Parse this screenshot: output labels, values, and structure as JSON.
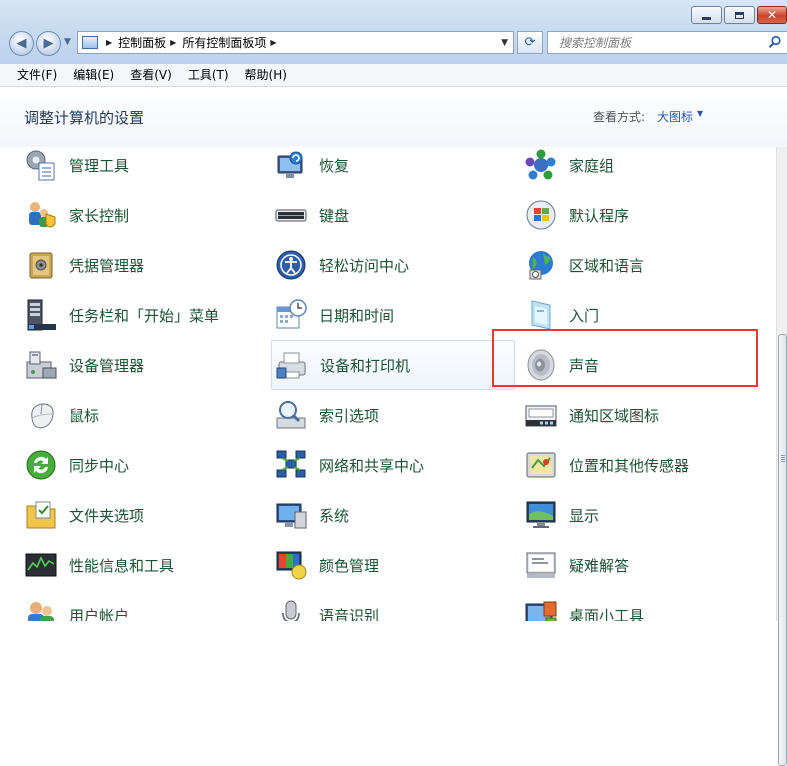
{
  "window": {
    "min_glyph": "—",
    "close_glyph": "✕"
  },
  "navigation": {
    "back_icon": "arrow-left-icon",
    "forward_icon": "arrow-right-icon",
    "address_crumbs": [
      "控制面板",
      "所有控制面板项"
    ],
    "refresh_icon": "refresh-icon",
    "search_placeholder": "搜索控制面板"
  },
  "menubar": {
    "items": [
      "文件(F)",
      "编辑(E)",
      "查看(V)",
      "工具(T)",
      "帮助(H)"
    ]
  },
  "content": {
    "title": "调整计算机的设置",
    "view_by_label": "查看方式:",
    "view_by_value": "大图标"
  },
  "items": [
    {
      "label": "管理工具",
      "icon": "admin-tools-icon"
    },
    {
      "label": "恢复",
      "icon": "recovery-icon"
    },
    {
      "label": "家庭组",
      "icon": "homegroup-icon"
    },
    {
      "label": "家长控制",
      "icon": "parental-controls-icon"
    },
    {
      "label": "键盘",
      "icon": "keyboard-icon"
    },
    {
      "label": "默认程序",
      "icon": "default-programs-icon"
    },
    {
      "label": "凭据管理器",
      "icon": "credential-manager-icon"
    },
    {
      "label": "轻松访问中心",
      "icon": "ease-of-access-icon"
    },
    {
      "label": "区域和语言",
      "icon": "region-language-icon"
    },
    {
      "label": "任务栏和「开始」菜单",
      "icon": "taskbar-icon"
    },
    {
      "label": "日期和时间",
      "icon": "date-time-icon"
    },
    {
      "label": "入门",
      "icon": "getting-started-icon"
    },
    {
      "label": "设备管理器",
      "icon": "device-manager-icon"
    },
    {
      "label": "设备和打印机",
      "icon": "devices-printers-icon"
    },
    {
      "label": "声音",
      "icon": "sound-icon"
    },
    {
      "label": "鼠标",
      "icon": "mouse-icon"
    },
    {
      "label": "索引选项",
      "icon": "indexing-options-icon"
    },
    {
      "label": "通知区域图标",
      "icon": "notification-area-icon"
    },
    {
      "label": "同步中心",
      "icon": "sync-center-icon"
    },
    {
      "label": "网络和共享中心",
      "icon": "network-sharing-icon"
    },
    {
      "label": "位置和其他传感器",
      "icon": "location-sensors-icon"
    },
    {
      "label": "文件夹选项",
      "icon": "folder-options-icon"
    },
    {
      "label": "系统",
      "icon": "system-icon"
    },
    {
      "label": "显示",
      "icon": "display-icon"
    },
    {
      "label": "性能信息和工具",
      "icon": "performance-icon"
    },
    {
      "label": "颜色管理",
      "icon": "color-management-icon"
    },
    {
      "label": "疑难解答",
      "icon": "troubleshooting-icon"
    },
    {
      "label": "用户帐户",
      "icon": "user-accounts-icon"
    },
    {
      "label": "语音识别",
      "icon": "speech-recognition-icon"
    },
    {
      "label": "桌面小工具",
      "icon": "desktop-gadgets-icon"
    }
  ],
  "colors": {
    "item_label": "#1c5233",
    "title": "#1e395b",
    "link": "#2459b2",
    "highlight": "#e53935"
  }
}
